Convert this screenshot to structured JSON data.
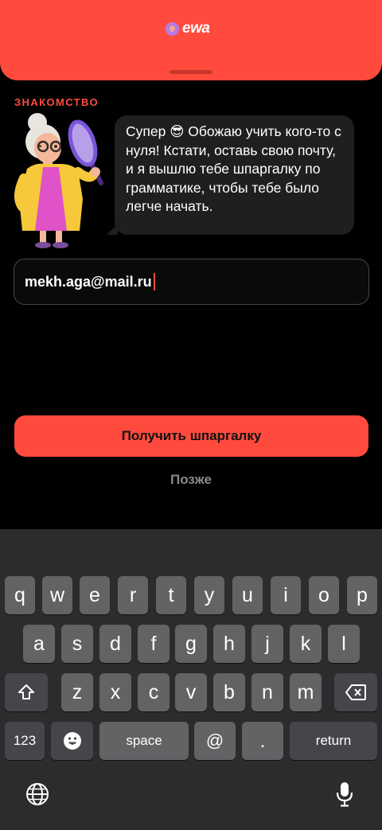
{
  "header": {
    "logo_text": "ewa",
    "accent_color": "#FF4A3D"
  },
  "section": {
    "label": "ЗНАКОМСТВО"
  },
  "message": {
    "text": "Супер 😎 Обожаю учить кого-то с нуля! Кстати, оставь свою почту, и я вышлю тебе шпаргалку по грамматике, чтобы тебе было легче начать."
  },
  "email": {
    "value": "mekh.aga@mail.ru"
  },
  "actions": {
    "primary_label": "Получить шпаргалку",
    "secondary_label": "Позже"
  },
  "keyboard": {
    "row1": [
      "q",
      "w",
      "e",
      "r",
      "t",
      "y",
      "u",
      "i",
      "o",
      "p"
    ],
    "row2": [
      "a",
      "s",
      "d",
      "f",
      "g",
      "h",
      "j",
      "k",
      "l"
    ],
    "row3": [
      "z",
      "x",
      "c",
      "v",
      "b",
      "n",
      "m"
    ],
    "numbers_label": "123",
    "space_label": "space",
    "at_label": "@",
    "dot_label": ".",
    "return_label": "return",
    "shift_icon": "shift-icon",
    "backspace_icon": "backspace-icon",
    "emoji_icon": "emoji-icon",
    "globe_icon": "globe-icon",
    "mic_icon": "microphone-icon"
  }
}
